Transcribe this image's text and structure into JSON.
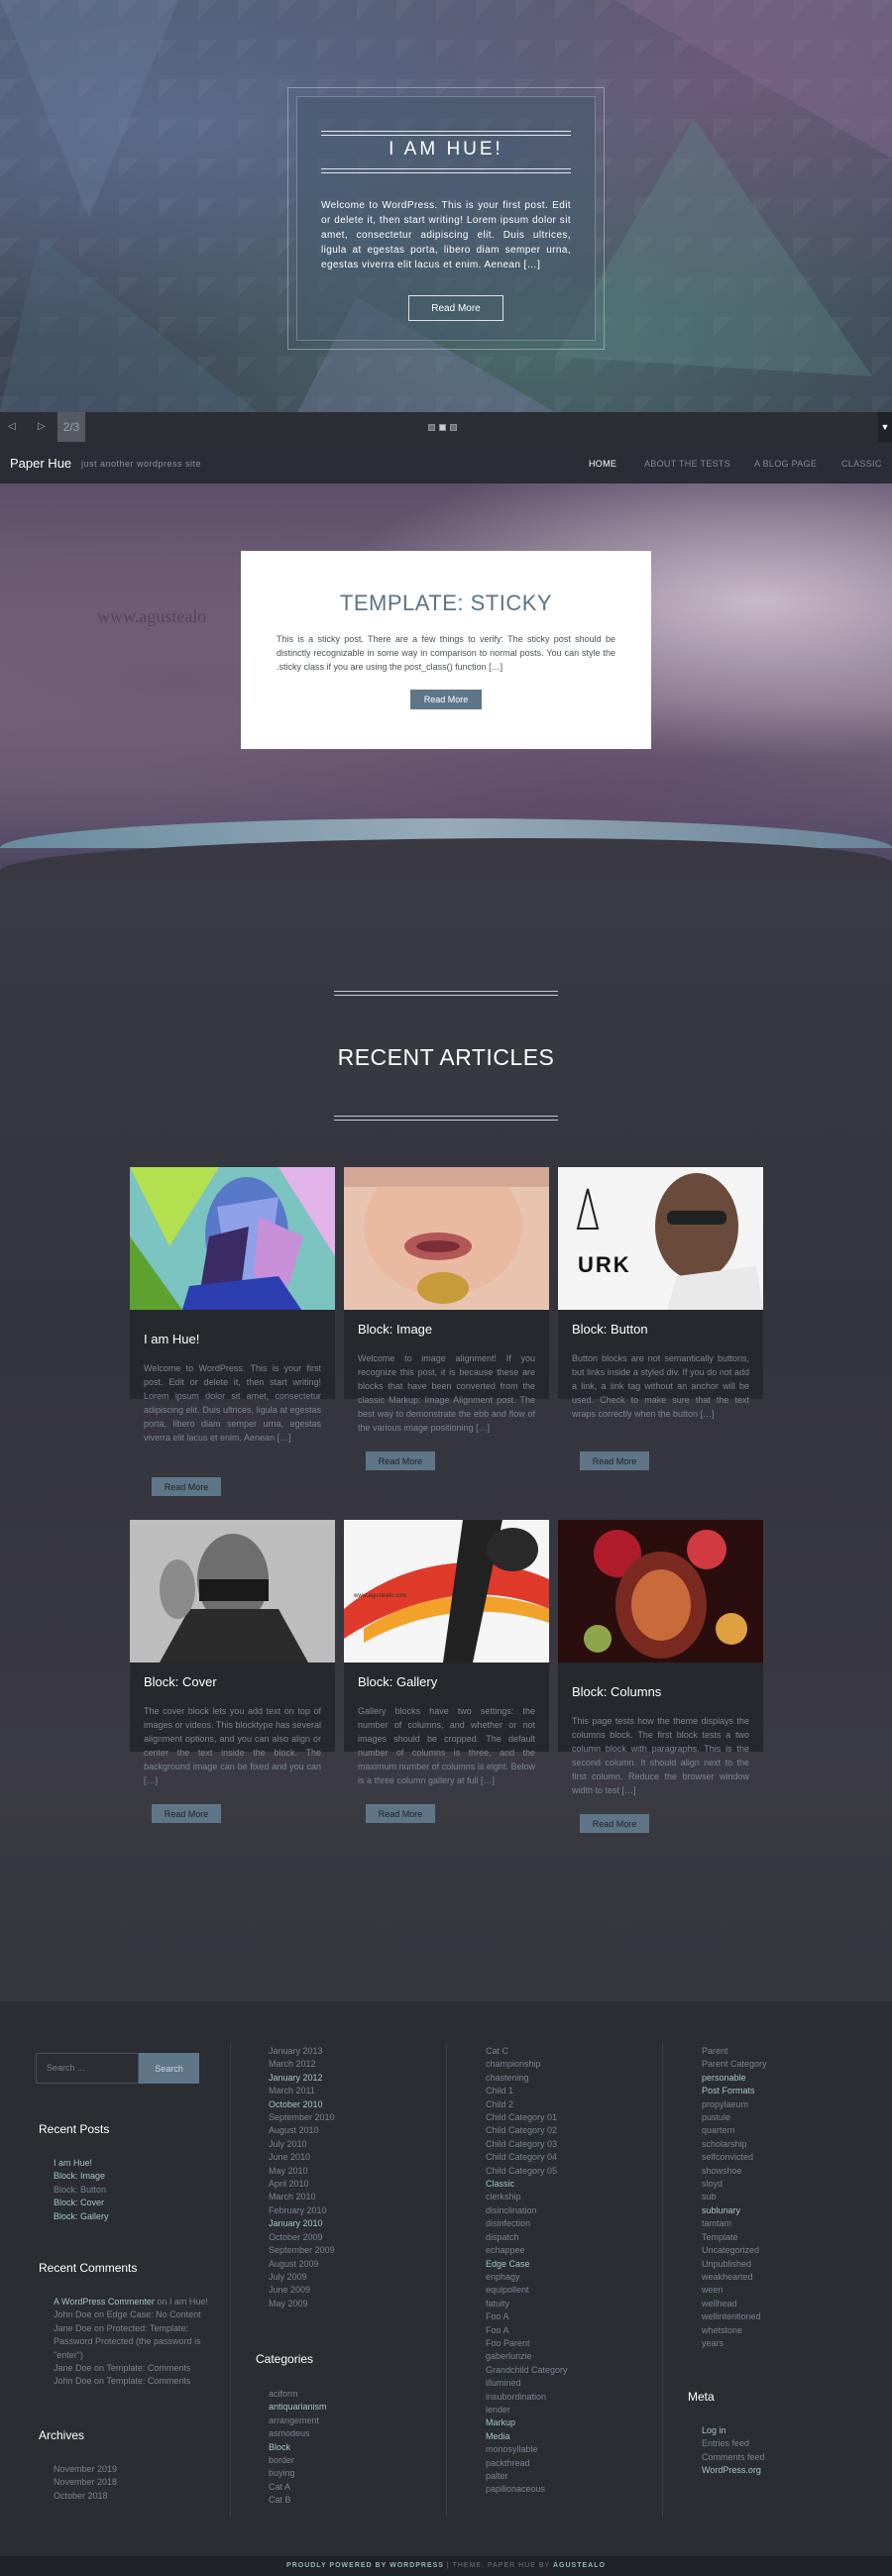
{
  "slider": {
    "title": "I AM HUE!",
    "excerpt": "Welcome to WordPress. This is your first post. Edit or delete it, then start writing! Lorem ipsum dolor sit amet, consectetur adipiscing elit. Duis ultrices, ligula at egestas porta, libero diam semper urna, egestas viverra elit lacus et enim. Aenean […]",
    "button": "Read More",
    "counter": "2/3",
    "prev": "◁",
    "next": "▷",
    "toggle": "▼"
  },
  "site": {
    "title": "Paper Hue",
    "tagline": "just another wordpress site"
  },
  "nav": {
    "items": [
      {
        "label": "HOME",
        "active": true
      },
      {
        "label": "ABOUT THE TESTS",
        "active": false
      },
      {
        "label": "A BLOG PAGE",
        "active": false
      },
      {
        "label": "CLASSIC",
        "active": false
      }
    ]
  },
  "sticky": {
    "watermark": "www.agustealo",
    "title": "TEMPLATE: STICKY",
    "excerpt": "This is a sticky post. There are a few things to verify: The sticky post should be distinctly recognizable in some way in comparison to normal posts. You can style the .sticky class if you are using the post_class() function […]",
    "button": "Read More"
  },
  "recent": {
    "heading": "RECENT ARTICLES",
    "cards": [
      {
        "title": "I am Hue!",
        "excerpt": "Welcome to WordPress. This is your first post. Edit or delete it, then start writing! Lorem ipsum dolor sit amet, consectetur adipiscing elit. Duis ultrices, ligula at egestas porta, libero diam semper urna, egestas viverra elit lacus et enim. Aenean […]",
        "button": "Read More"
      },
      {
        "title": "Block: Image",
        "excerpt": "Welcome to image alignment! If you recognize this post, it is because these are blocks that have been converted from the classic Markup: Image Alignment post. The best way to demonstrate the ebb and flow of the various image positioning […]",
        "button": "Read More"
      },
      {
        "title": "Block: Button",
        "excerpt": "Button blocks are not semantically buttons, but links inside a styled div. If you do not add a link, a link tag without an anchor will be used. Check to make sure that the text wraps correctly when the button […]",
        "button": "Read More",
        "image_text": "URK"
      },
      {
        "title": "Block: Cover",
        "excerpt": "The cover block lets you add text on top of images or videos. This blocktype has several alignment options, and you can also align or center the text inside the block. The background image can be fixed and you can […]",
        "button": "Read More"
      },
      {
        "title": "Block: Gallery",
        "excerpt": "Gallery blocks have two settings: the number of columns, and whether or not images should be cropped. The default number of columns is three, and the maximum number of columns is eight. Below is a three column gallery at full […]",
        "button": "Read More",
        "image_text": "www.agustealo.com"
      },
      {
        "title": "Block: Columns",
        "excerpt": "This page tests how the theme displays the columns block. The first block tests a two column block with paragraphs. This is the second column. It should align next to the first column. Reduce the browser window width to test […]",
        "button": "Read More"
      }
    ]
  },
  "footer": {
    "search": {
      "placeholder": "Search ...",
      "button": "Search"
    },
    "recent_posts": {
      "heading": "Recent Posts",
      "items": [
        "I am Hue!",
        "Block: Image",
        "Block: Button",
        "Block: Cover",
        "Block: Gallery"
      ]
    },
    "recent_comments": {
      "heading": "Recent Comments",
      "items": [
        {
          "author": "A WordPress Commenter",
          "on": "on",
          "post": "I am Hue!"
        },
        {
          "author": "John Doe",
          "on": "on",
          "post": "Edge Case: No Content"
        },
        {
          "author": "Jane Doe",
          "on": "on",
          "post": "Protected: Template: Password Protected (the password is \"enter\")"
        },
        {
          "author": "Jane Doe",
          "on": "on",
          "post": "Template: Comments"
        },
        {
          "author": "John Doe",
          "on": "on",
          "post": "Template: Comments"
        }
      ]
    },
    "archives_footer": {
      "heading": "Archives",
      "items": [
        "November 2019",
        "November 2018",
        "October 2018"
      ]
    },
    "archives_list": [
      "January 2013",
      "March 2012",
      "January 2012",
      "March 2011",
      "October 2010",
      "September 2010",
      "August 2010",
      "July 2010",
      "June 2010",
      "May 2010",
      "April 2010",
      "March 2010",
      "February 2010",
      "January 2010",
      "October 2009",
      "September 2009",
      "August 2009",
      "July 2009",
      "June 2009",
      "May 2009"
    ],
    "categories": {
      "heading": "Categories",
      "items": [
        "aciform",
        "antiquarianism",
        "arrangement",
        "asmodeus",
        "Block",
        "border",
        "buying",
        "Cat A",
        "Cat B"
      ]
    },
    "categories_col3": [
      "Cat C",
      "championship",
      "chastening",
      "Child 1",
      "Child 2",
      "Child Category 01",
      "Child Category 02",
      "Child Category 03",
      "Child Category 04",
      "Child Category 05",
      "Classic",
      "clerkship",
      "disinclination",
      "disinfection",
      "dispatch",
      "echappee",
      "Edge Case",
      "enphagy",
      "equipollent",
      "fatuity",
      "Foo A",
      "Foo A",
      "Foo Parent",
      "gaberlunzie",
      "Grandchild Category",
      "illumined",
      "insubordination",
      "lender",
      "Markup",
      "Media",
      "monosyllable",
      "packthread",
      "palter",
      "papilionaceous"
    ],
    "categories_col4": [
      "Parent",
      "Parent Category",
      "personable",
      "Post Formats",
      "propylaeum",
      "pustule",
      "quartern",
      "scholarship",
      "selfconvicted",
      "showshoe",
      "sloyd",
      "sub",
      "sublunary",
      "tamtam",
      "Template",
      "Uncategorized",
      "Unpublished",
      "weakhearted",
      "ween",
      "wellhead",
      "wellintentioned",
      "whetstone",
      "years"
    ],
    "meta": {
      "heading": "Meta",
      "items": [
        "Log in",
        "Entries feed",
        "Comments feed",
        "WordPress.org"
      ]
    },
    "credits": {
      "powered": "PROUDLY POWERED BY WORDPRESS",
      "theme": " | THEME: PAPER HUE BY ",
      "author": "AGUSTEALO"
    }
  },
  "colors": {
    "accent": "#5f7689",
    "link_highlight": "#a7c7c3",
    "footer_bg": "#2a2d31",
    "card_bg": "#25282d"
  }
}
